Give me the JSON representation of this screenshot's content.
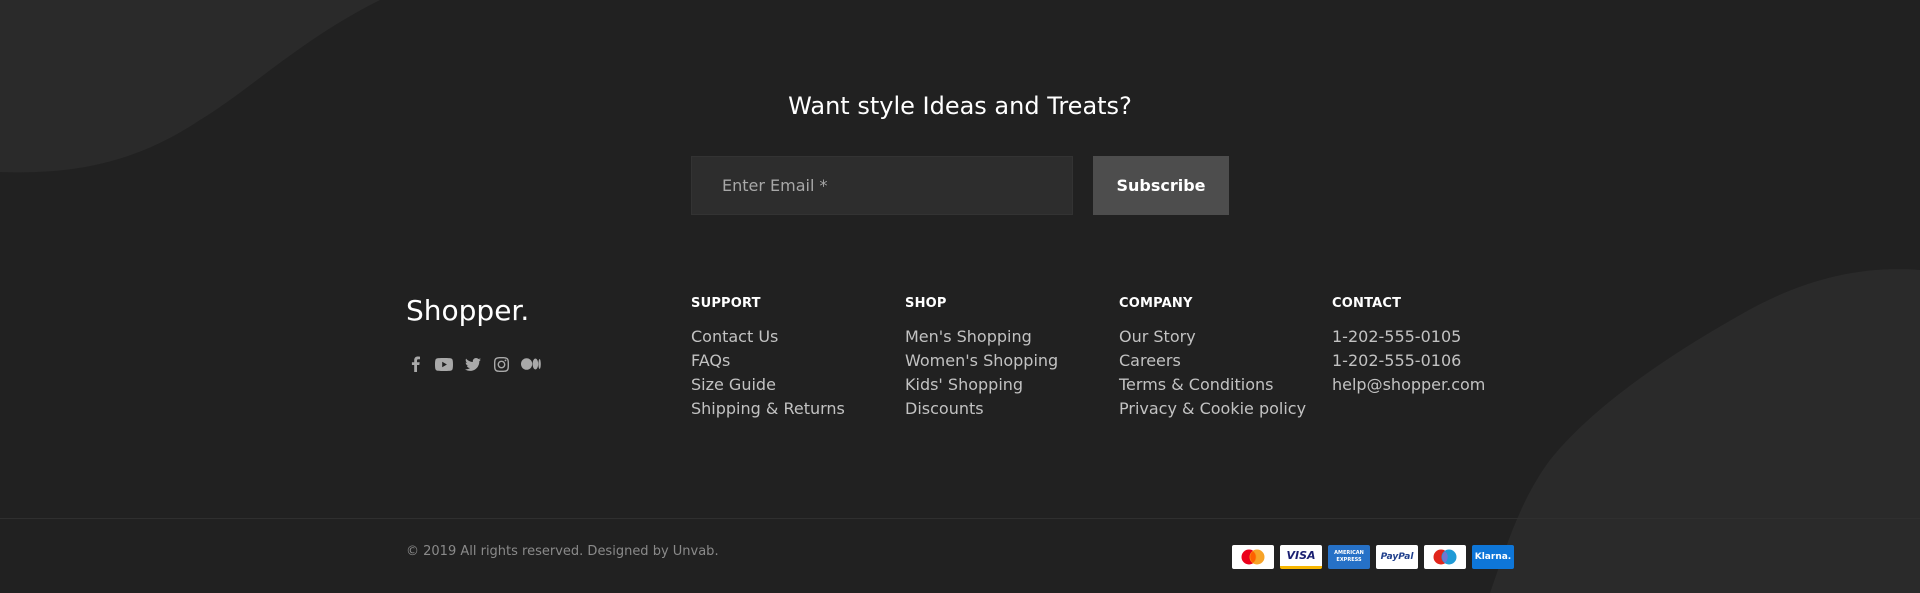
{
  "newsletter": {
    "heading": "Want style Ideas and Treats?",
    "email_placeholder": "Enter Email *",
    "subscribe_label": "Subscribe"
  },
  "footer": {
    "brand": "Shopper.",
    "social_icons": [
      "facebook-icon",
      "youtube-icon",
      "twitter-icon",
      "instagram-icon",
      "medium-icon"
    ],
    "columns": {
      "support": {
        "title": "SUPPORT",
        "items": [
          "Contact Us",
          "FAQs",
          "Size Guide",
          "Shipping & Returns"
        ]
      },
      "shop": {
        "title": "SHOP",
        "items": [
          "Men's Shopping",
          "Women's Shopping",
          "Kids' Shopping",
          "Discounts"
        ]
      },
      "company": {
        "title": "COMPANY",
        "items": [
          "Our Story",
          "Careers",
          "Terms & Conditions",
          "Privacy & Cookie policy"
        ]
      },
      "contact": {
        "title": "CONTACT",
        "items": [
          "1-202-555-0105",
          "1-202-555-0106",
          "help@shopper.com"
        ]
      }
    }
  },
  "bottom": {
    "copyright": "© 2019 All rights reserved. Designed by Unvab.",
    "payments": {
      "mastercard": "mastercard-icon",
      "visa": "VISA",
      "amex_line1": "AMERICAN",
      "amex_line2": "EXPRESS",
      "paypal": "PayPal",
      "maestro": "maestro-icon",
      "klarna": "Klarna."
    }
  },
  "colors": {
    "background": "#212121",
    "input_bg": "#2d2d2d",
    "button_bg": "#4d4d4d",
    "link_text": "#c2c2c2",
    "muted_text": "#8a8a8a"
  }
}
